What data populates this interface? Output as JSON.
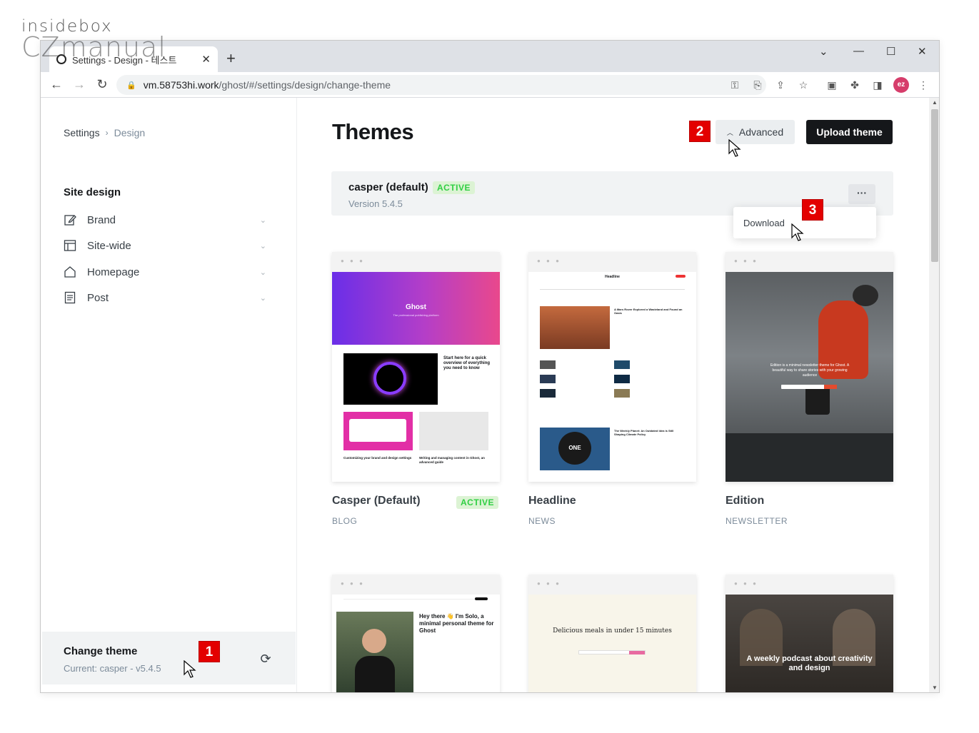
{
  "watermark": {
    "line1": "insidebox",
    "line2": "CZmanual"
  },
  "browser": {
    "tab_title": "Settings - Design - 테스트",
    "url_host": "vm.58753hi.work",
    "url_path": "/ghost/#/settings/design/change-theme",
    "avatar_initials": "ez"
  },
  "sidebar": {
    "breadcrumb": {
      "parent": "Settings",
      "current": "Design"
    },
    "section_title": "Site design",
    "items": [
      {
        "label": "Brand",
        "icon": "edit-icon"
      },
      {
        "label": "Site-wide",
        "icon": "layout-icon"
      },
      {
        "label": "Homepage",
        "icon": "home-icon"
      },
      {
        "label": "Post",
        "icon": "document-icon"
      }
    ],
    "change_theme": {
      "title": "Change theme",
      "subtitle": "Current: casper - v5.4.5"
    }
  },
  "main": {
    "title": "Themes",
    "advanced_label": "Advanced",
    "upload_label": "Upload theme",
    "active_theme": {
      "name": "casper (default)",
      "badge": "ACTIVE",
      "version": "Version 5.4.5",
      "menu_label": "···"
    },
    "dropdown": {
      "download_label": "Download"
    },
    "themes": [
      {
        "name": "Casper (Default)",
        "category": "BLOG",
        "badge": "ACTIVE"
      },
      {
        "name": "Headline",
        "category": "NEWS"
      },
      {
        "name": "Edition",
        "category": "NEWSLETTER"
      }
    ],
    "previews": {
      "casper_hero": "Ghost",
      "casper_hero_sub": "The professional publishing platform",
      "casper_post1": "Start here for a quick overview of everything you need to know",
      "casper_post2": "Customizing your brand and design settings",
      "casper_post3": "Writing and managing content in Ghost, an advanced guide",
      "headline_logo": "Headline",
      "headline_post": "A Mars Rover Explored a Wasteland and Found an Oasis",
      "headline_env": "The Weekly Planet: An Outdated Idea is Still Shaping Climate Policy",
      "edition_text": "Edition is a minimal newsletter theme for Ghost. A beautiful way to share stories with your growing audience",
      "solo_text": "Hey there 👋 I'm Solo, a minimal personal theme for Ghost",
      "taste_text": "Delicious meals in under 15 minutes",
      "episode_text": "A weekly podcast about creativity and design"
    }
  },
  "markers": [
    "1",
    "2",
    "3"
  ],
  "colors": {
    "accent": "#15171a",
    "active_green": "#30cf43",
    "marker_red": "#e30000",
    "casper_gradient_start": "#6a2ee8",
    "casper_gradient_end": "#e9488c"
  }
}
